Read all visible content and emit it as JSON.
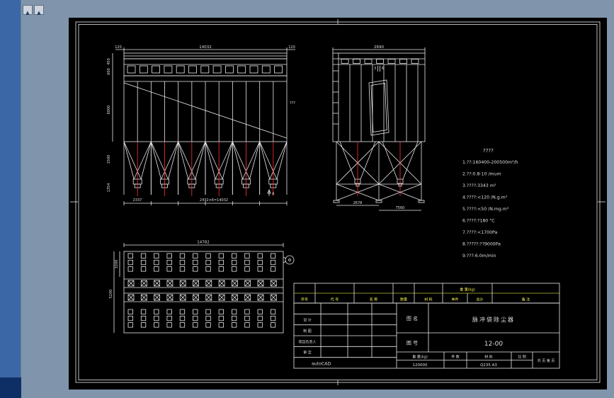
{
  "front_view": {
    "dim_top": "14032",
    "dim_top_left": "120",
    "dim_top_right": "120",
    "dim_left": [
      "450",
      "600",
      "6000",
      "1500",
      "1354"
    ],
    "dim_right": "???",
    "dim_bottom_left": "2337",
    "dim_bottom": "2432×6=14032",
    "marker": "A"
  },
  "side_view": {
    "dim_top": "2690",
    "label_3": "3",
    "label_6": "6",
    "dim_bottom_left": "2678",
    "dim_bottom_right": "7560"
  },
  "plan_view": {
    "dim_top": "14782",
    "dim_left_top": "3200",
    "dim_left_bottom": "5200"
  },
  "specs": {
    "title": "????",
    "lines": [
      "1.??:160400-200500m³/h",
      "2.??:0.8-10 /mum",
      "3.????:3343 m²",
      "4.????:<120 /N.g.m³",
      "5.????:<50 /N.mg.m³",
      "6.????:?180 °C",
      "7.????:<1700Pa",
      "8.?????:??9000Pa",
      "9.???:6.0m/min"
    ]
  },
  "bom": {
    "span_header": "重 量(kg)",
    "headers": [
      "序号",
      "代  号",
      "名  称",
      "数量",
      "材  料",
      "单件",
      "总计",
      "备  注"
    ]
  },
  "title_block": {
    "rows": [
      "设  计",
      "制  图",
      "项目负责人",
      "审  定"
    ],
    "software": "autoCAD",
    "name_label": "图  名",
    "name_value": "脉冲袋除尘器",
    "no_label": "图  号",
    "no_value": "12-00",
    "weight_label": "重 量(kg)",
    "qty_label": "件 数",
    "material_label": "材 料",
    "scale_label": "比 例",
    "weight_value": "120000",
    "material_value": "Q235 A3",
    "pages": "共 页 第 页"
  }
}
